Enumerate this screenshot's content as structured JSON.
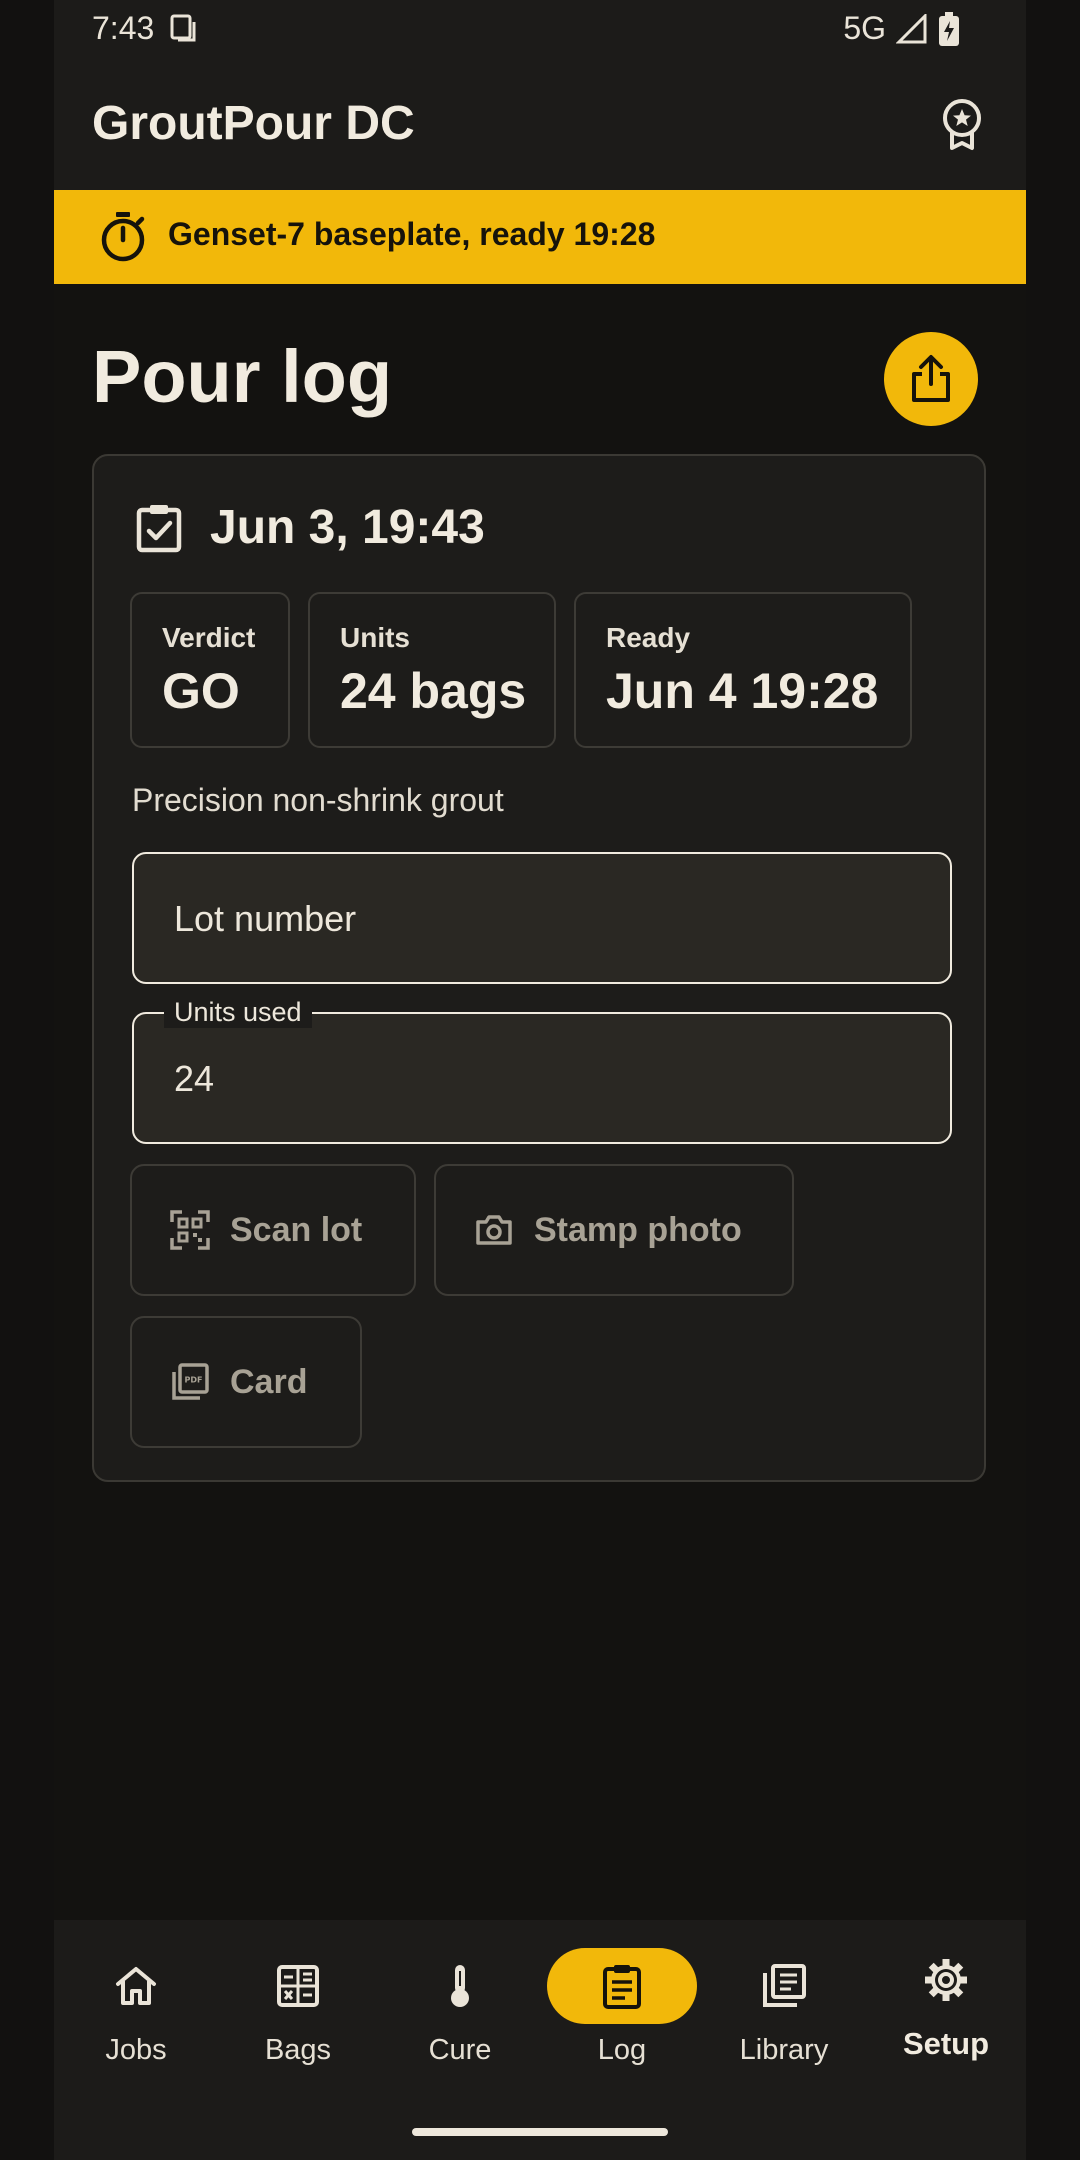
{
  "status": {
    "time": "7:43",
    "network": "5G"
  },
  "app": {
    "title": "GroutPour DC"
  },
  "banner": {
    "text": "Genset-7 baseplate, ready 19:28"
  },
  "page": {
    "title": "Pour log"
  },
  "entry": {
    "date": "Jun 3, 19:43",
    "chips": [
      {
        "label": "Verdict",
        "value": "GO"
      },
      {
        "label": "Units",
        "value": "24 bags"
      },
      {
        "label": "Ready",
        "value": "Jun 4 19:28"
      }
    ],
    "product": "Precision non-shrink grout",
    "lot_field": {
      "placeholder": "Lot number",
      "value": ""
    },
    "units_field": {
      "label": "Units used",
      "value": "24"
    },
    "actions": {
      "scan": "Scan lot",
      "photo": "Stamp photo",
      "card": "Card"
    }
  },
  "nav": {
    "items": [
      {
        "label": "Jobs",
        "icon": "home-icon"
      },
      {
        "label": "Bags",
        "icon": "calculator-icon"
      },
      {
        "label": "Cure",
        "icon": "thermometer-icon"
      },
      {
        "label": "Log",
        "icon": "clipboard-icon",
        "active": true
      },
      {
        "label": "Library",
        "icon": "library-icon"
      },
      {
        "label": "Setup",
        "icon": "gear-icon"
      }
    ]
  },
  "colors": {
    "accent": "#F2B80A",
    "background": "#131210",
    "surface": "#1D1C1A"
  }
}
